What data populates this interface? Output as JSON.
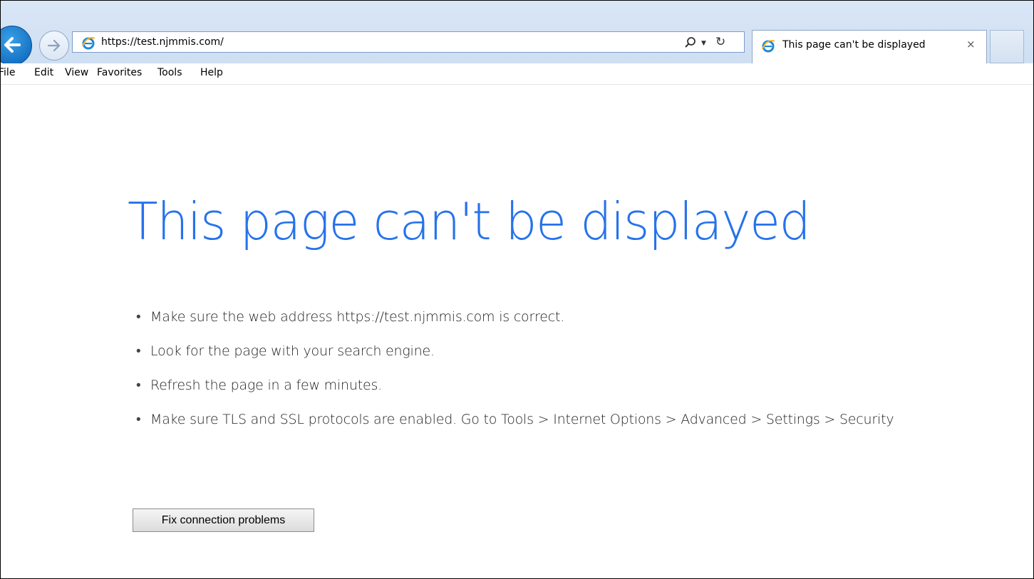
{
  "browser": {
    "address_bar": {
      "url": "https://test.njmmis.com/"
    },
    "tab": {
      "title": "This page can't be displayed",
      "close_label": "×"
    },
    "icons": {
      "back": "back-arrow-icon",
      "forward": "forward-arrow-icon",
      "site": "ie-icon",
      "search": "search-icon",
      "dropdown": "dropdown-icon",
      "refresh": "refresh-icon"
    },
    "menu": [
      "File",
      "Edit",
      "View",
      "Favorites",
      "Tools",
      "Help"
    ]
  },
  "page": {
    "heading": "This page can't be displayed",
    "suggestions": [
      "Make sure the web address https://test.njmmis.com is correct.",
      "Look for the page with your search engine.",
      "Refresh the page in a few minutes.",
      "Make sure TLS and SSL protocols are enabled. Go to Tools > Internet Options > Advanced > Settings > Security"
    ],
    "fix_button_label": "Fix connection problems"
  },
  "colors": {
    "heading": "#2672ec",
    "chrome": "#d9e6f6",
    "back_button": "#1673c6"
  }
}
